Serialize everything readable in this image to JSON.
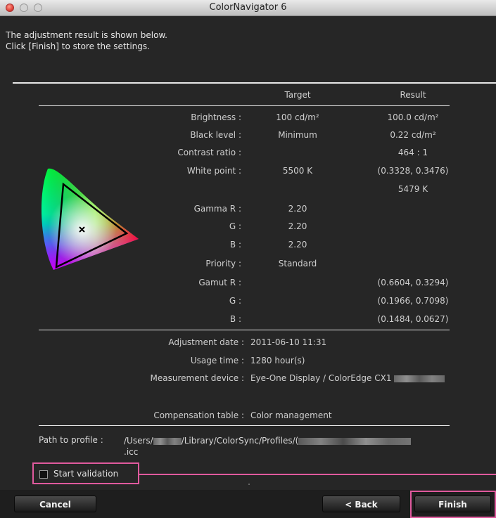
{
  "window": {
    "title": "ColorNavigator 6"
  },
  "intro": {
    "line1": "The adjustment result is shown below.",
    "line2": "Click [Finish] to store the settings."
  },
  "columns": {
    "target": "Target",
    "result": "Result"
  },
  "rows": [
    {
      "label": "Brightness :",
      "target": "100 cd/m²",
      "result": "100.0 cd/m²"
    },
    {
      "label": "Black level :",
      "target": "Minimum",
      "result": "0.22 cd/m²"
    },
    {
      "label": "Contrast ratio :",
      "target": "",
      "result": "464 : 1"
    },
    {
      "label": "White point :",
      "target": "5500 K",
      "result": "(0.3328, 0.3476)"
    },
    {
      "label": "",
      "target": "",
      "result": "5479 K"
    },
    {
      "label": "Gamma R :",
      "target": "2.20",
      "result": ""
    },
    {
      "label": "G :",
      "target": "2.20",
      "result": ""
    },
    {
      "label": "B :",
      "target": "2.20",
      "result": ""
    },
    {
      "label": "Priority :",
      "target": "Standard",
      "result": ""
    },
    {
      "label": "Gamut R :",
      "target": "",
      "result": "(0.6604, 0.3294)"
    },
    {
      "label": "G :",
      "target": "",
      "result": "(0.1966, 0.7098)"
    },
    {
      "label": "B :",
      "target": "",
      "result": "(0.1484, 0.0627)"
    }
  ],
  "details": [
    {
      "label": "Adjustment date :",
      "value": "2011-06-10 11:31"
    },
    {
      "label": "Usage time :",
      "value": "1280 hour(s)"
    },
    {
      "label": "Measurement device :",
      "value": "Eye-One Display / ColorEdge CX1"
    },
    {
      "label": "Compensation table :",
      "value": "Color management"
    }
  ],
  "profile": {
    "label": "Path to profile :",
    "part1": "/Users/",
    "part2": "/Library/ColorSync/Profiles/(",
    "ext": ".icc"
  },
  "validation": {
    "label": "Start validation",
    "checked": false
  },
  "buttons": {
    "cancel": "Cancel",
    "back": "< Back",
    "finish": "Finish"
  },
  "colors": {
    "highlight": "#e05a9e",
    "background": "#262626"
  },
  "icons": {
    "gamut_diagram": "cie-chromaticity-diagram-icon",
    "white_point_marker": "cross-marker-icon"
  }
}
